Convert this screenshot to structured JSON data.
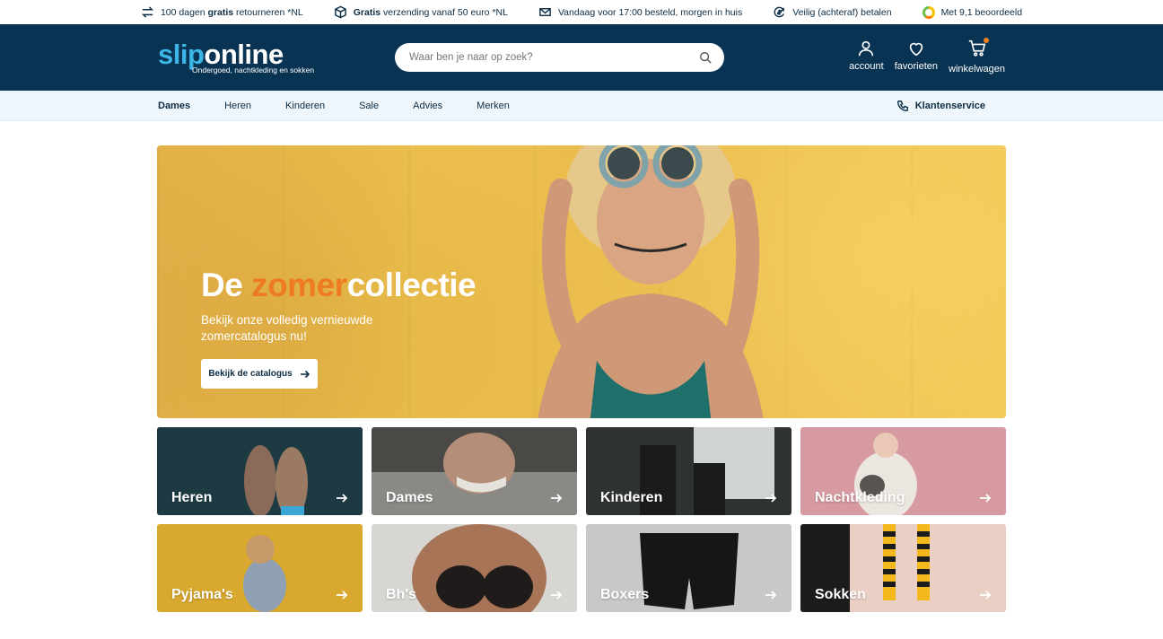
{
  "usp_bar": {
    "items": [
      {
        "icon": "return-arrows-icon",
        "pre": "100 dagen ",
        "bold": "gratis",
        "post": " retourneren *NL"
      },
      {
        "icon": "package-icon",
        "pre": "",
        "bold": "Gratis",
        "post": " verzending vanaf 50 euro *NL"
      },
      {
        "icon": "delivery-envelope-icon",
        "pre": "Vandaag voor 17:00 besteld, morgen in huis",
        "bold": "",
        "post": ""
      },
      {
        "icon": "secure-payment-icon",
        "pre": "Veilig (achteraf) betalen",
        "bold": "",
        "post": ""
      },
      {
        "icon": "rating-badge-icon",
        "pre": "Met 9,1 beoordeeld",
        "bold": "",
        "post": ""
      }
    ]
  },
  "header": {
    "logo_part1": "slip",
    "logo_part2": "online",
    "logo_tagline": "Ondergoed, nachtkleding en sokken",
    "search_placeholder": "Waar ben je naar op zoek?",
    "account_label": "account",
    "favorites_label": "favorieten",
    "cart_label": "winkelwagen"
  },
  "nav": {
    "items": [
      "Dames",
      "Heren",
      "Kinderen",
      "Sale",
      "Advies",
      "Merken"
    ],
    "active": "Dames",
    "service_label": "Klantenservice"
  },
  "hero": {
    "title_part1": "De ",
    "title_accent": "zomer",
    "title_part2": "collectie",
    "subtitle": "Bekijk onze volledig vernieuwde zomercatalogus nu!",
    "button_label": "Bekijk de catalogus"
  },
  "categories": [
    {
      "label": "Heren",
      "bg": "#1d3a42"
    },
    {
      "label": "Dames",
      "bg": "#3a3a38"
    },
    {
      "label": "Kinderen",
      "bg": "#2e3231"
    },
    {
      "label": "Nachtkleding",
      "bg": "#d79aa0"
    },
    {
      "label": "Pyjama's",
      "bg": "#d9a92f"
    },
    {
      "label": "Bh's",
      "bg": "#d8d6d3"
    },
    {
      "label": "Boxers",
      "bg": "#c9c8c6"
    },
    {
      "label": "Sokken",
      "bg": "#e9cfc4"
    }
  ],
  "colors": {
    "brand_dark": "#083352",
    "brand_light_blue": "#3db5e6",
    "accent_orange": "#ee7b22",
    "nav_bg": "#eef6fc"
  }
}
